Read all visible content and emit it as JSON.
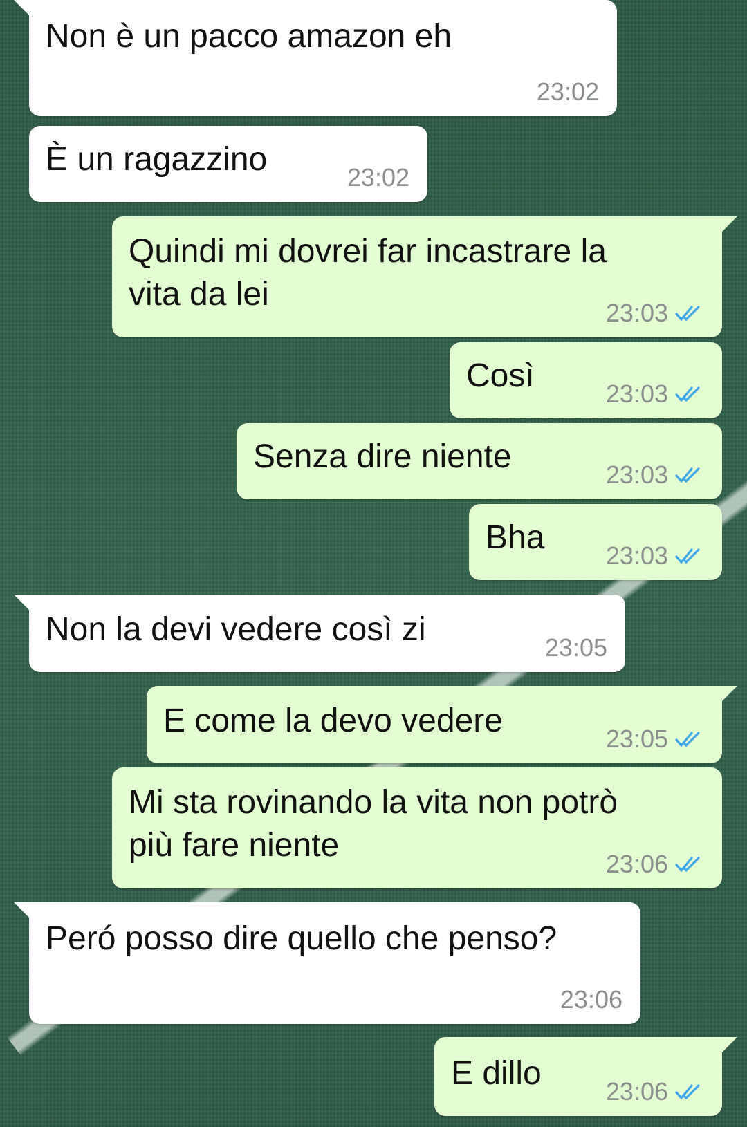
{
  "colors": {
    "incoming_bubble": "#ffffff",
    "outgoing_bubble": "#e3fed1",
    "timestamp": "#8a8f8c",
    "read_ticks": "#3fa6e8"
  },
  "messages": [
    {
      "direction": "in",
      "text": "Non è un pacco amazon eh",
      "time": "23:02"
    },
    {
      "direction": "in",
      "text": "È un ragazzino",
      "time": "23:02"
    },
    {
      "direction": "out",
      "text": "Quindi mi dovrei far incastrare la\nvita da lei",
      "time": "23:03",
      "status": "read-double-check-icon"
    },
    {
      "direction": "out",
      "text": "Così",
      "time": "23:03",
      "status": "read-double-check-icon"
    },
    {
      "direction": "out",
      "text": "Senza dire niente",
      "time": "23:03",
      "status": "read-double-check-icon"
    },
    {
      "direction": "out",
      "text": "Bha",
      "time": "23:03",
      "status": "read-double-check-icon"
    },
    {
      "direction": "in",
      "text": "Non la devi vedere così zi",
      "time": "23:05"
    },
    {
      "direction": "out",
      "text": "E come la devo vedere",
      "time": "23:05",
      "status": "read-double-check-icon"
    },
    {
      "direction": "out",
      "text": "Mi sta rovinando la vita non potrò\npiù fare niente",
      "time": "23:06",
      "status": "read-double-check-icon"
    },
    {
      "direction": "in",
      "text": "Peró posso dire quello che penso?",
      "time": "23:06"
    },
    {
      "direction": "out",
      "text": "E dillo",
      "time": "23:06",
      "status": "read-double-check-icon"
    }
  ]
}
